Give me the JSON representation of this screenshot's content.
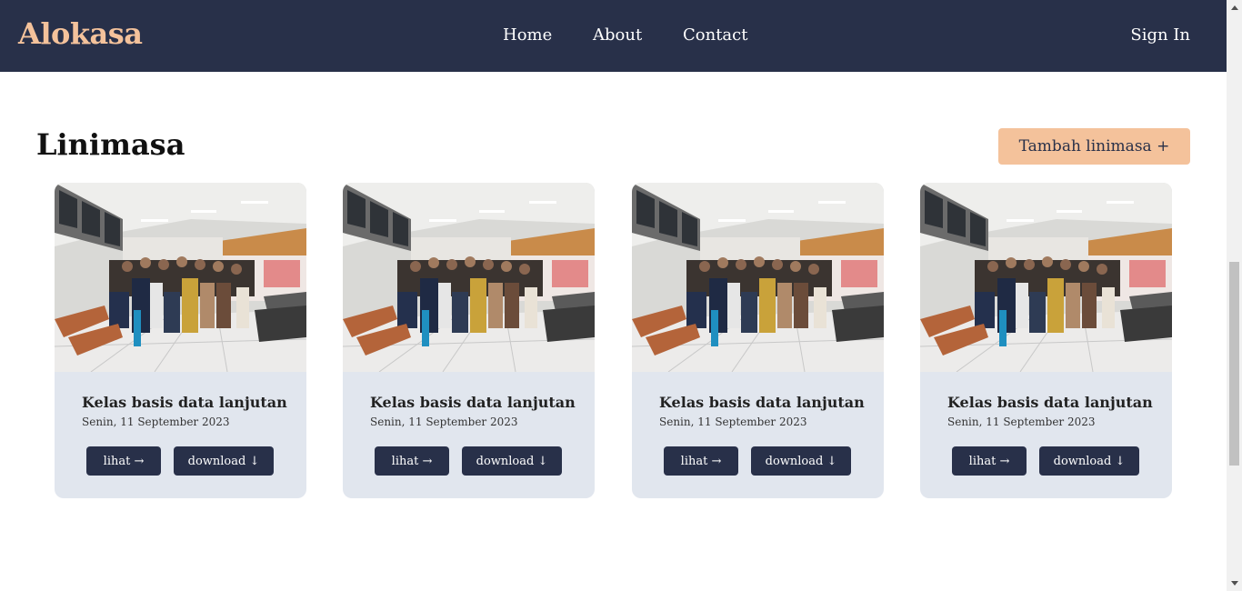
{
  "brand": "Alokasa",
  "nav": {
    "home": "Home",
    "about": "About",
    "contact": "Contact",
    "signin": "Sign In"
  },
  "page": {
    "title": "Linimasa",
    "add_button": "Tambah linimasa +"
  },
  "cards": [
    {
      "title": "Kelas basis data lanjutan",
      "date": "Senin, 11 September 2023",
      "view_label": "lihat →",
      "download_label": "download ↓"
    },
    {
      "title": "Kelas basis data lanjutan",
      "date": "Senin, 11 September 2023",
      "view_label": "lihat →",
      "download_label": "download ↓"
    },
    {
      "title": "Kelas basis data lanjutan",
      "date": "Senin, 11 September 2023",
      "view_label": "lihat →",
      "download_label": "download ↓"
    },
    {
      "title": "Kelas basis data lanjutan",
      "date": "Senin, 11 September 2023",
      "view_label": "lihat →",
      "download_label": "download ↓"
    }
  ],
  "colors": {
    "navbar": "#283049",
    "brand": "#f4c29b",
    "accent_button": "#f4c29b",
    "card_bg": "#e1e6ee",
    "card_button": "#283049"
  }
}
